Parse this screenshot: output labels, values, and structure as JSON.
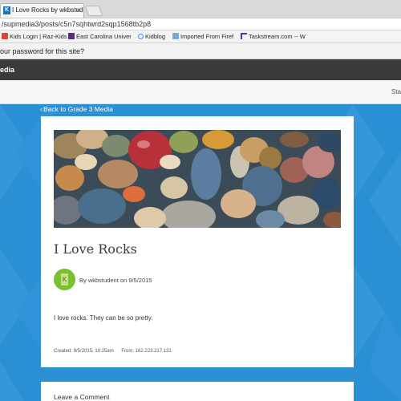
{
  "browser": {
    "tab": {
      "title": "I Love Rocks by wkbstuden",
      "favicon": "K",
      "close": "×"
    },
    "url": "/supmedia3/posts/c5n7sqhtwrd2sqp1568tb2p8",
    "bookmarks": [
      {
        "label": "Kids Login | Raz-Kids",
        "icon": "book-icon",
        "color": "#d34a2a"
      },
      {
        "label": "East Carolina Univer",
        "icon": "university-icon",
        "color": "#5a2d82"
      },
      {
        "label": "Kidblog",
        "icon": "google-icon",
        "color": "#4285f4"
      },
      {
        "label": "Imported From Firef",
        "icon": "folder-icon",
        "color": "#7ea6d6"
      },
      {
        "label": "Taskstream.com -- W",
        "icon": "taskstream-icon",
        "color": "#3a3ab8"
      }
    ],
    "infobar_text": "our password for this site?"
  },
  "site": {
    "header_text": "edia",
    "status_text": "Sta"
  },
  "back_link": "Back to Grade 3 Media",
  "post": {
    "title": "I Love Rocks",
    "byline": "By wkbstudent on 9/5/2015",
    "body": "I love rocks. They can be so pretty.",
    "created": "Created: 9/5/2015, 10:25am",
    "from": "From: 162.223.217.131"
  },
  "comment": {
    "title": "Leave a Comment"
  },
  "colors": {
    "page_background": "#2b8fd4",
    "header_dark": "#3a3a3a",
    "avatar_green": "#7ac12f"
  }
}
